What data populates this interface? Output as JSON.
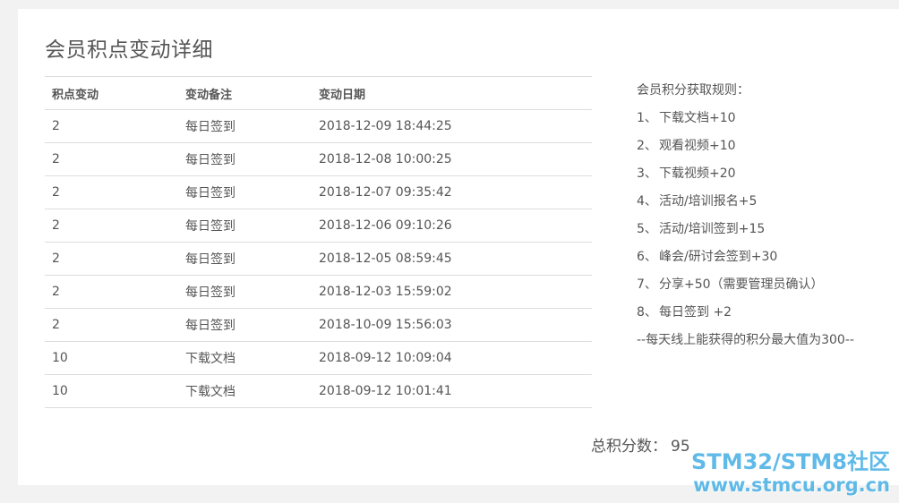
{
  "page": {
    "title": "会员积点变动详细"
  },
  "table": {
    "headers": [
      "积点变动",
      "变动备注",
      "变动日期"
    ],
    "rows": [
      [
        "2",
        "每日签到",
        "2018-12-09 18:44:25"
      ],
      [
        "2",
        "每日签到",
        "2018-12-08 10:00:25"
      ],
      [
        "2",
        "每日签到",
        "2018-12-07 09:35:42"
      ],
      [
        "2",
        "每日签到",
        "2018-12-06 09:10:26"
      ],
      [
        "2",
        "每日签到",
        "2018-12-05 08:59:45"
      ],
      [
        "2",
        "每日签到",
        "2018-12-03 15:59:02"
      ],
      [
        "2",
        "每日签到",
        "2018-10-09 15:56:03"
      ],
      [
        "10",
        "下载文档",
        "2018-09-12 10:09:04"
      ],
      [
        "10",
        "下载文档",
        "2018-09-12 10:01:41"
      ]
    ]
  },
  "rules": {
    "title": "会员积分获取规则：",
    "items": [
      {
        "num": "1、",
        "text": "下载文档+10"
      },
      {
        "num": "2、",
        "text": "观看视频+10"
      },
      {
        "num": "3、",
        "text": "下载视频+20"
      },
      {
        "num": "4、",
        "text": "活动/培训报名+5"
      },
      {
        "num": "5、",
        "text": "活动/培训签到+15"
      },
      {
        "num": "6、",
        "text": "峰会/研讨会签到+30"
      },
      {
        "num": "7、",
        "text": "分享+50（需要管理员确认）"
      },
      {
        "num": "8、",
        "text": "每日签到 +2"
      }
    ],
    "note": "--每天线上能获得的积分最大值为300--"
  },
  "total": {
    "label": "总积分数：",
    "value": "95"
  },
  "watermark": {
    "line1": "STM32/STM8社区",
    "line2": "www.stmcu.org.cn"
  }
}
